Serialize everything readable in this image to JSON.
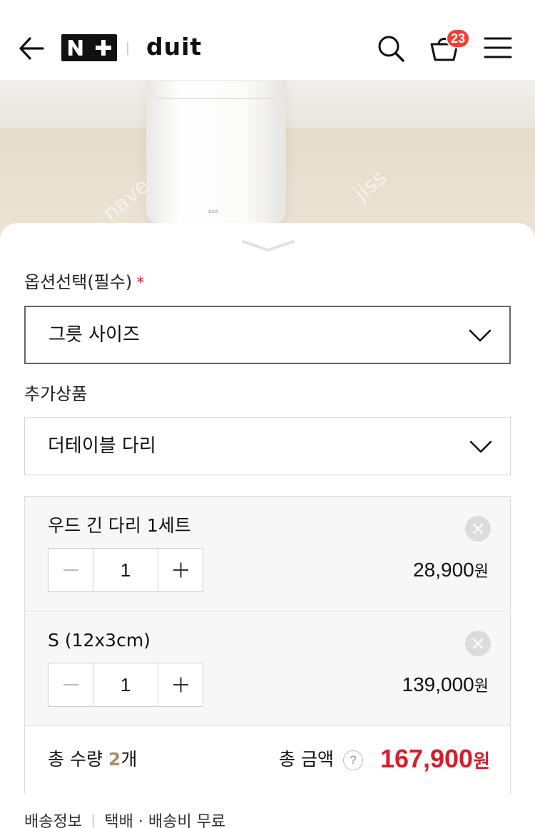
{
  "header": {
    "brand_logo": "N+",
    "brand_name": "duit",
    "cart_count": "23",
    "icons": [
      "back-arrow-icon",
      "search-icon",
      "shopping-bag-icon",
      "menu-icon"
    ]
  },
  "options": {
    "required_label": "옵션선택(필수)",
    "required_mark": "*",
    "option_value": "그릇 사이즈",
    "extra_label": "추가상품",
    "extra_value": "더테이블 다리"
  },
  "selected_items": [
    {
      "name": "우드 긴 다리 1세트",
      "quantity": "1",
      "price": "28,900",
      "currency": "원"
    },
    {
      "name": "S (12x3cm)",
      "quantity": "1",
      "price": "139,000",
      "currency": "원"
    }
  ],
  "summary": {
    "qty_prefix": "총 수량 ",
    "qty_value": "2",
    "qty_suffix": "개",
    "amount_label": "총 금액",
    "help_mark": "?",
    "total_price": "167,900",
    "currency": "원"
  },
  "delivery": {
    "label": "배송정보",
    "method": "택배",
    "fee": "배송비 무료"
  },
  "colors": {
    "accent_red": "#d21f2c",
    "badge_red": "#f33d34",
    "qty_gold": "#a88d6c"
  }
}
